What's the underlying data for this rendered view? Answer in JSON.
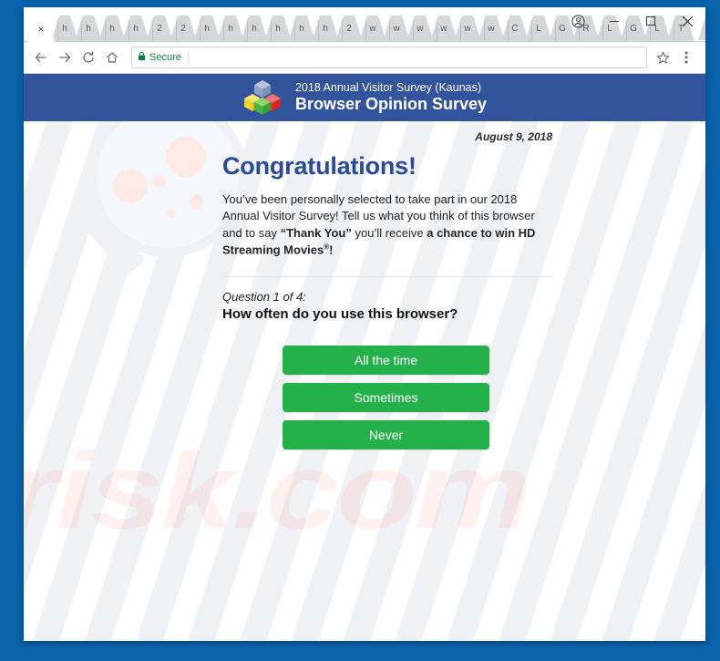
{
  "browser": {
    "tabs": [
      {
        "label": "×",
        "active": true,
        "name": "tab-active-close"
      },
      {
        "label": "h",
        "active": false
      },
      {
        "label": "h",
        "active": false
      },
      {
        "label": "h",
        "active": false
      },
      {
        "label": "h",
        "active": false
      },
      {
        "label": "2",
        "active": false
      },
      {
        "label": "2",
        "active": false
      },
      {
        "label": "h",
        "active": false
      },
      {
        "label": "h",
        "active": false
      },
      {
        "label": "h",
        "active": false
      },
      {
        "label": "h",
        "active": false
      },
      {
        "label": "h",
        "active": false
      },
      {
        "label": "h",
        "active": false
      },
      {
        "label": "2",
        "active": false
      },
      {
        "label": "w",
        "active": false
      },
      {
        "label": "w",
        "active": false
      },
      {
        "label": "w",
        "active": false
      },
      {
        "label": "w",
        "active": false
      },
      {
        "label": "w",
        "active": false
      },
      {
        "label": "w",
        "active": false
      },
      {
        "label": "C",
        "active": false
      },
      {
        "label": "L",
        "active": false
      },
      {
        "label": "G",
        "active": false
      },
      {
        "label": "R",
        "active": false
      },
      {
        "label": "L",
        "active": false
      },
      {
        "label": "G",
        "active": false
      },
      {
        "label": "L",
        "active": false
      },
      {
        "label": "T",
        "active": false
      }
    ],
    "new_tab_icon": "new-tab-icon",
    "profile_icon": "profile-avatar-icon",
    "minimize_icon": "minimize-icon",
    "maximize_icon": "maximize-icon",
    "close_icon": "close-icon",
    "back_icon": "back-arrow-icon",
    "forward_icon": "forward-arrow-icon",
    "reload_icon": "reload-icon",
    "home_icon": "home-icon",
    "lock_icon": "lock-icon",
    "secure_label": "Secure",
    "url_value": "",
    "url_placeholder": "",
    "star_icon": "star-bookmark-icon",
    "menu_icon": "three-dot-menu-icon"
  },
  "survey": {
    "subtitle": "2018 Annual Visitor Survey (Kaunas)",
    "title": "Browser Opinion Survey",
    "logo_icon": "colored-cubes-logo-icon",
    "logo_colors": {
      "top": "#8fa5c8",
      "left": "#f2d527",
      "center": "#49b549",
      "right": "#ec3a3a"
    },
    "date": "August 9, 2018",
    "heading": "Congratulations!",
    "intro": {
      "part1": "You’ve been personally selected to take part in our 2018 Annual Visitor Survey! Tell us what you think of this browser and to say ",
      "quote": "“Thank You”",
      "part2": " you’ll receive ",
      "bold_offer": "a chance to win HD Streaming Movies",
      "registered": "®",
      "part3": "!"
    },
    "question_number": "Question 1 of 4:",
    "question_text": "How often do you use this browser?",
    "answers": [
      {
        "label": "All the time"
      },
      {
        "label": "Sometimes"
      },
      {
        "label": "Never"
      }
    ],
    "accent_header_color": "#32549c",
    "accent_heading_color": "#2a4b9b",
    "accent_button_color": "#24b14a"
  },
  "watermark": {
    "text": "risk.com",
    "magnifier_icon": "magnifying-glass-watermark-icon"
  }
}
